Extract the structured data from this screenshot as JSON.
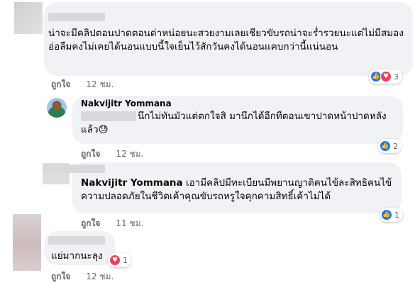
{
  "comments": [
    {
      "text": "น่าจะมีคลิปตอนปาดตอนด่าหน่อยนะสวยงามเลยเชียวขับรถน่าจะร่ำรวยนะแต่ไม่มีสมองอ่อลืมคงไม่เคยได้นอนแบบนี้ใจเย็นไว้สักวันคงได้นอนแคบกว่านี้แน่นอน",
      "like_label": "ถูกใจ",
      "time": "12 ชม.",
      "reaction_count": "3",
      "reaction_icons": [
        "like-icon",
        "love-icon"
      ]
    },
    {
      "author": "Nakvijitr Yommana",
      "text": "นึกไม่ทันมัวแต่ตกใจสิ มานึกได้อีกทีตอนเขาปาดหน้าปาดหลังแล้ว😓",
      "like_label": "ถูกใจ",
      "time": "12 ชม.",
      "reaction_count": "2",
      "reaction_icons": [
        "like-icon"
      ]
    },
    {
      "mention": "Nakvijitr Yommana",
      "text": "เอามีคลิปมีทะเบียนมีพยานญาติคนไข้ละสิทธิคนไข้ความปลอดภัยในชีวิตเค้าคุณขับรถหรูใจคุกคามสิทธิ์เค้าไม่ได้",
      "like_label": "ถูกใจ",
      "time": "11 ชม.",
      "reaction_count": "1",
      "reaction_icons": [
        "like-icon"
      ]
    },
    {
      "text": "แย่มากนะลุง",
      "like_label": "ถูกใจ",
      "time": "12 ชม.",
      "reaction_count": "1",
      "reaction_icons": [
        "love-icon"
      ]
    }
  ],
  "colors": {
    "like_blue": "#1877f2",
    "love_red": "#f33e58",
    "bubble": "#f0f2f5",
    "meta_gray": "#65676b"
  }
}
